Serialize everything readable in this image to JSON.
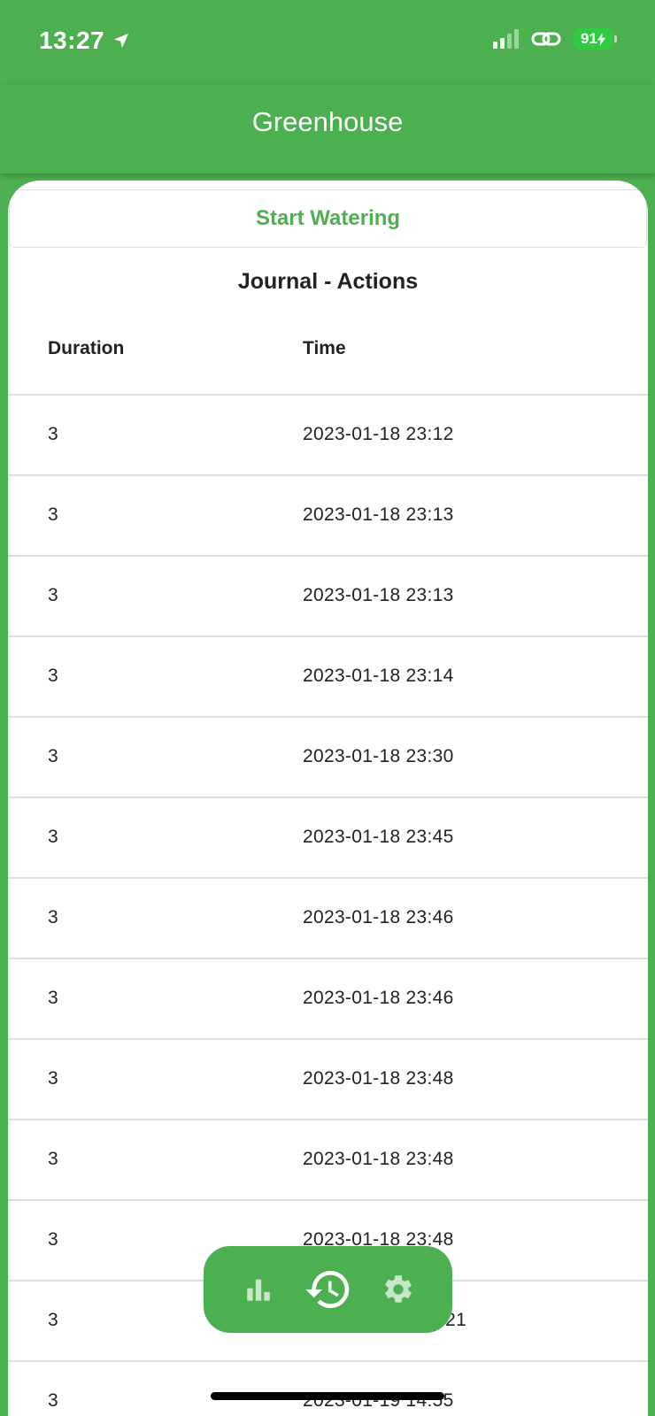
{
  "status_bar": {
    "time": "13:27",
    "battery": "91"
  },
  "app": {
    "title": "Greenhouse",
    "brand_color": "#4caf50"
  },
  "actions": {
    "start_watering": "Start Watering"
  },
  "journal": {
    "title": "Journal - Actions",
    "columns": [
      "Duration",
      "Time"
    ],
    "rows": [
      {
        "duration": "3",
        "time": "2023-01-18 23:12"
      },
      {
        "duration": "3",
        "time": "2023-01-18 23:13"
      },
      {
        "duration": "3",
        "time": "2023-01-18 23:13"
      },
      {
        "duration": "3",
        "time": "2023-01-18 23:14"
      },
      {
        "duration": "3",
        "time": "2023-01-18 23:30"
      },
      {
        "duration": "3",
        "time": "2023-01-18 23:45"
      },
      {
        "duration": "3",
        "time": "2023-01-18 23:46"
      },
      {
        "duration": "3",
        "time": "2023-01-18 23:46"
      },
      {
        "duration": "3",
        "time": "2023-01-18 23:48"
      },
      {
        "duration": "3",
        "time": "2023-01-18 23:48"
      },
      {
        "duration": "3",
        "time": "2023-01-18 23:48"
      },
      {
        "duration": "3",
        "time": ":21"
      },
      {
        "duration": "3",
        "time": "2023-01-19 14:55"
      }
    ]
  },
  "bottom_nav": {
    "items": [
      {
        "icon": "bar-chart-icon",
        "active": false
      },
      {
        "icon": "history-icon",
        "active": true
      },
      {
        "icon": "gear-icon",
        "active": false
      }
    ]
  }
}
